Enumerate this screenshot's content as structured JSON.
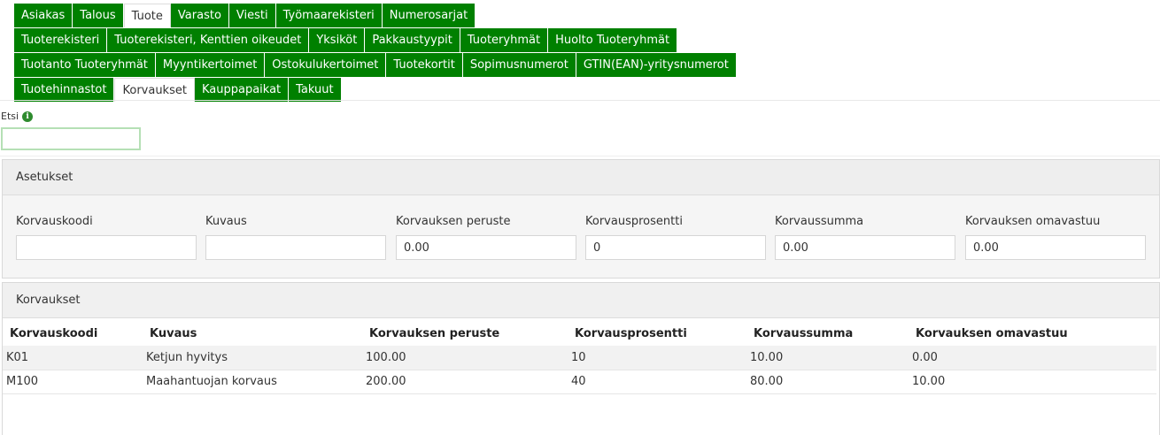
{
  "nav": {
    "rows": [
      [
        {
          "label": "Asiakas",
          "active": false
        },
        {
          "label": "Talous",
          "active": false
        },
        {
          "label": "Tuote",
          "active": true
        },
        {
          "label": "Varasto",
          "active": false
        },
        {
          "label": "Viesti",
          "active": false
        },
        {
          "label": "Työmaarekisteri",
          "active": false
        },
        {
          "label": "Numerosarjat",
          "active": false
        }
      ],
      [
        {
          "label": "Tuoterekisteri",
          "active": false
        },
        {
          "label": "Tuoterekisteri, Kenttien oikeudet",
          "active": false
        },
        {
          "label": "Yksiköt",
          "active": false
        },
        {
          "label": "Pakkaustyypit",
          "active": false
        },
        {
          "label": "Tuoteryhmät",
          "active": false
        },
        {
          "label": "Huolto Tuoteryhmät",
          "active": false
        }
      ],
      [
        {
          "label": "Tuotanto Tuoteryhmät",
          "active": false
        },
        {
          "label": "Myyntikertoimet",
          "active": false
        },
        {
          "label": "Ostokulukertoimet",
          "active": false
        },
        {
          "label": "Tuotekortit",
          "active": false
        },
        {
          "label": "Sopimusnumerot",
          "active": false
        },
        {
          "label": "GTIN(EAN)-yritysnumerot",
          "active": false
        }
      ],
      [
        {
          "label": "Tuotehinnastot",
          "active": false
        },
        {
          "label": "Korvaukset",
          "active": true
        },
        {
          "label": "Kauppapaikat",
          "active": false
        },
        {
          "label": "Takuut",
          "active": false
        }
      ]
    ]
  },
  "search": {
    "label": "Etsi",
    "value": ""
  },
  "settings": {
    "title": "Asetukset",
    "fields": [
      {
        "label": "Korvauskoodi",
        "value": ""
      },
      {
        "label": "Kuvaus",
        "value": ""
      },
      {
        "label": "Korvauksen peruste",
        "value": "0.00"
      },
      {
        "label": "Korvausprosentti",
        "value": "0"
      },
      {
        "label": "Korvaussumma",
        "value": "0.00"
      },
      {
        "label": "Korvauksen omavastuu",
        "value": "0.00"
      }
    ]
  },
  "compensations": {
    "title": "Korvaukset",
    "columns": [
      "Korvauskoodi",
      "Kuvaus",
      "Korvauksen peruste",
      "Korvausprosentti",
      "Korvaussumma",
      "Korvauksen omavastuu"
    ],
    "rows": [
      [
        "K01",
        "Ketjun hyvitys",
        "100.00",
        "10",
        "10.00",
        "0.00"
      ],
      [
        "M100",
        "Maahantuojan korvaus",
        "200.00",
        "40",
        "80.00",
        "10.00"
      ]
    ]
  },
  "colors": {
    "accent": "#008000",
    "info_icon": "#2e8b2e"
  },
  "icons": {
    "info": "info-icon"
  }
}
